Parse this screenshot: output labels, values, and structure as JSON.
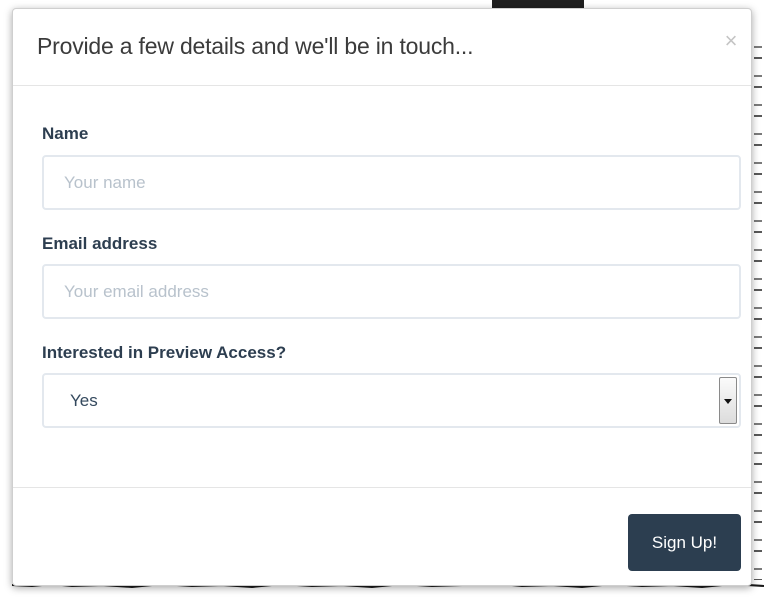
{
  "modal": {
    "title": "Provide a few details and we'll be in touch...",
    "close_glyph": "×"
  },
  "form": {
    "name": {
      "label": "Name",
      "placeholder": "Your name",
      "value": ""
    },
    "email": {
      "label": "Email address",
      "placeholder": "Your email address",
      "value": ""
    },
    "preview_access": {
      "label": "Interested in Preview Access?",
      "selected": "Yes"
    }
  },
  "footer": {
    "submit_label": "Sign Up!"
  },
  "colors": {
    "primary_button": "#2c3e50",
    "label_text": "#2d3e50",
    "input_border": "#e3e8ee",
    "placeholder": "#b8c2cc"
  }
}
